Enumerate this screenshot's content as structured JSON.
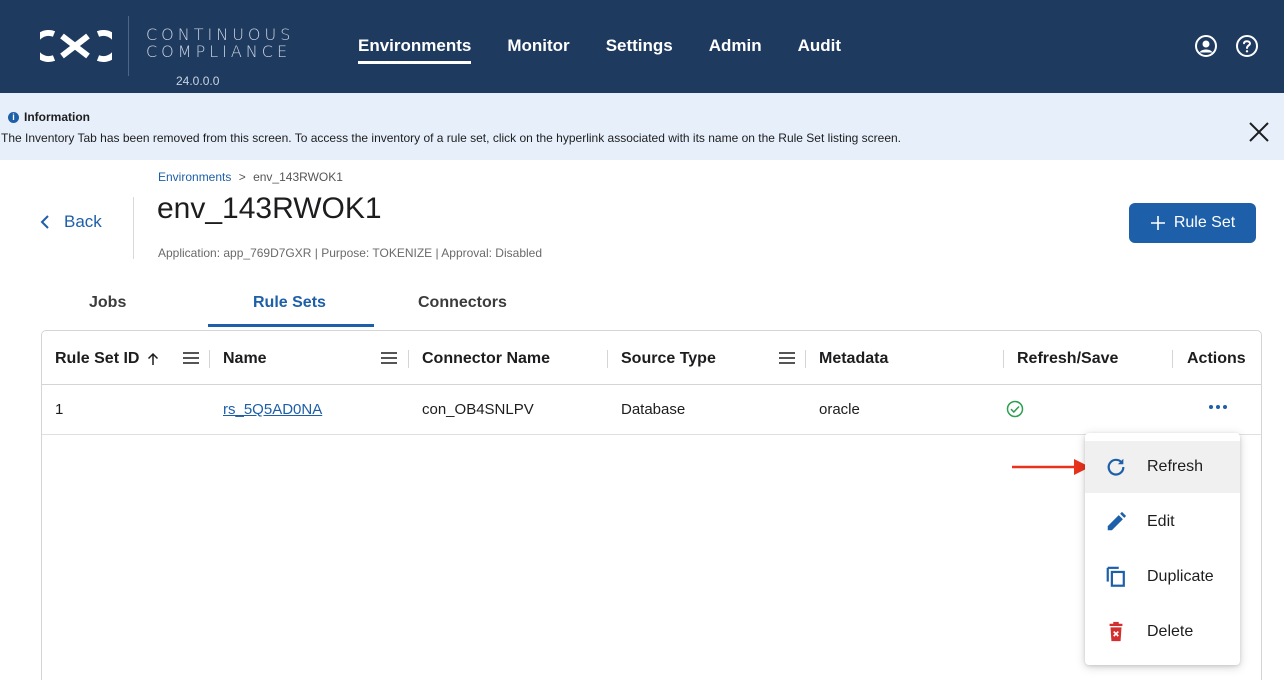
{
  "header": {
    "brand_line1": "CONTINUOUS",
    "brand_line2": "COMPLIANCE",
    "version": "24.0.0.0",
    "nav": [
      "Environments",
      "Monitor",
      "Settings",
      "Admin",
      "Audit"
    ],
    "active_nav": "Environments",
    "icons": [
      "user-account-icon",
      "help-icon"
    ],
    "background_color": "#1f3a5f"
  },
  "info_banner": {
    "title": "Information",
    "message": "The Inventory Tab has been removed from this screen. To access the inventory of a rule set, click on the hyperlink associated with its name on the Rule Set listing screen."
  },
  "page": {
    "back_label": "Back",
    "breadcrumb": [
      "Environments",
      "env_143RWOK1"
    ],
    "breadcrumb_separator": ">",
    "title": "env_143RWOK1",
    "subtitle": "Application: app_769D7GXR | Purpose: TOKENIZE | Approval: Disabled",
    "add_button_label": "Rule Set",
    "accent_color": "#1d5fa8"
  },
  "tabs": [
    "Jobs",
    "Rule Sets",
    "Connectors"
  ],
  "active_tab": "Rule Sets",
  "table": {
    "columns": [
      "Rule Set ID",
      "Name",
      "Connector Name",
      "Source Type",
      "Metadata",
      "Refresh/Save",
      "Actions"
    ],
    "sort": {
      "column": "Rule Set ID",
      "direction": "ascending"
    },
    "rows": [
      {
        "id": "1",
        "name": "rs_5Q5AD0NA",
        "connector": "con_OB4SNLPV",
        "source_type": "Database",
        "metadata": "oracle",
        "refresh_save_icon": "check-circle-icon",
        "actions_icon": "more-horizontal-icon"
      }
    ]
  },
  "context_menu": {
    "items": [
      {
        "label": "Refresh",
        "icon": "refresh-icon"
      },
      {
        "label": "Edit",
        "icon": "pencil-icon"
      },
      {
        "label": "Duplicate",
        "icon": "duplicate-icon"
      },
      {
        "label": "Delete",
        "icon": "trash-icon"
      }
    ],
    "highlighted": "Refresh",
    "annotation_arrow_color": "#e8321c",
    "delete_icon_color": "#d32f2f"
  }
}
